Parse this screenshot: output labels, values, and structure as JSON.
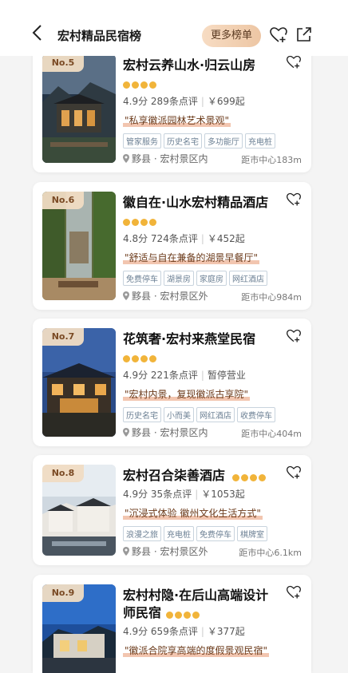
{
  "header": {
    "title": "宏村精品民宿榜",
    "more_button": "更多榜单"
  },
  "icons": {
    "back": "chevron-left-icon",
    "heart": "heart-plus-icon",
    "share": "share-icon",
    "pin": "location-pin-icon"
  },
  "colors": {
    "accent_star": "#f1b43a",
    "badge_bg": "#f0dcc3",
    "more_button_bg": "#edc6a4",
    "tag_border": "#c8d3dd",
    "quote_highlight": "#e8966e"
  },
  "cards": [
    {
      "rank": "No.5",
      "name": "宏村云养山水·归云山房",
      "stars": 4,
      "rating": "4.9分",
      "reviews": "289条点评",
      "price": "￥699起",
      "quote": "\"私享徽派园林艺术景观\"",
      "tags": [
        "管家服务",
        "历史名宅",
        "多功能厅",
        "充电桩"
      ],
      "county": "黟县",
      "area": "宏村景区内",
      "distance": "距市中心183m"
    },
    {
      "rank": "No.6",
      "name": "徽自在·山水宏村精品酒店",
      "stars": 4,
      "rating": "4.8分",
      "reviews": "724条点评",
      "price": "￥452起",
      "quote": "\"舒适与自在兼备的湖景早餐厅\"",
      "tags": [
        "免费停车",
        "湖景房",
        "家庭房",
        "网红酒店"
      ],
      "county": "黟县",
      "area": "宏村景区外",
      "distance": "距市中心984m"
    },
    {
      "rank": "No.7",
      "name": "花筑奢·宏村来燕堂民宿",
      "stars": 4,
      "rating": "4.9分",
      "reviews": "221条点评",
      "price": "暂停营业",
      "quote": "\"宏村内景，复现徽派古享院\"",
      "tags": [
        "历史名宅",
        "小而美",
        "网红酒店",
        "收费停车"
      ],
      "county": "黟县",
      "area": "宏村景区内",
      "distance": "距市中心404m"
    },
    {
      "rank": "No.8",
      "name": "宏村召合柒善酒店",
      "stars": 4,
      "rating": "4.9分",
      "reviews": "35条点评",
      "price": "￥1053起",
      "quote": "\"沉浸式体验 徽州文化生活方式\"",
      "tags": [
        "浪漫之旅",
        "充电桩",
        "免费停车",
        "棋牌室"
      ],
      "county": "黟县",
      "area": "宏村景区外",
      "distance": "距市中心6.1km"
    },
    {
      "rank": "No.9",
      "name_line1": "宏村村隐·在后山高端设计",
      "name_line2": "师民宿",
      "stars": 4,
      "rating": "4.9分",
      "reviews": "659条点评",
      "price": "￥377起",
      "quote": "\"徽派合院享高端的度假景观民宿\""
    }
  ]
}
